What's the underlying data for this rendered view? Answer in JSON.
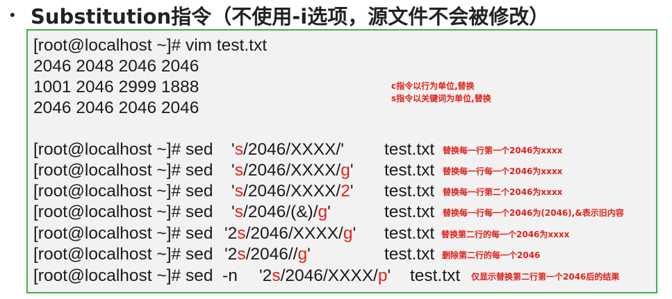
{
  "title": {
    "bullet": "•",
    "text": "Substitution指令（不使用-i选项，源文件不会被修改）"
  },
  "file_content": {
    "command": "[root@localhost ~]# vim test.txt",
    "lines": [
      "2046 2048 2046 2046",
      "1001 2046 2999 1888",
      "2046 2046 2046 2046"
    ]
  },
  "notes": {
    "c_note": "c指令以行为单位,替换",
    "s_note": "s指令以关键词为单位,替换"
  },
  "commands": [
    {
      "prompt": "[root@localhost ~]# sed  ",
      "p1": "'",
      "r1": "s",
      "p2": "/2046/XXXX/'",
      "r2": "",
      "p3": "",
      "file": "test.txt",
      "note": "替换每一行第一个2046为xxxx"
    },
    {
      "prompt": "[root@localhost ~]# sed  ",
      "p1": "'",
      "r1": "s",
      "p2": "/2046/XXXX/",
      "r2": "g",
      "p3": "'",
      "file": "test.txt",
      "note": "替换每一行每一个2046为xxxx"
    },
    {
      "prompt": "[root@localhost ~]# sed  ",
      "p1": "'",
      "r1": "s",
      "p2": "/2046/XXXX/",
      "r2": "2",
      "p3": "'",
      "file": "test.txt",
      "note": "替换每一行第二个2046为xxxx"
    },
    {
      "prompt": "[root@localhost ~]# sed  ",
      "p1": "'",
      "r1": "s",
      "p2": "/2046/(&)/",
      "r2": "g",
      "p3": "'",
      "file": "test.txt",
      "note": "替换每一行每一个2046为(2046),&表示旧内容"
    },
    {
      "prompt": "[root@localhost ~]# sed  ",
      "p1": "'2",
      "r1": "s",
      "p2": "/2046/XXXX/",
      "r2": "g",
      "p3": "'",
      "file": "test.txt",
      "note": "替换第二行的每一个2046为xxxx"
    },
    {
      "prompt": "[root@localhost ~]# sed  ",
      "p1": "'2",
      "r1": "s",
      "p2": "/2046//",
      "r2": "g",
      "p3": "'",
      "file": "test.txt",
      "note": "删除第二行的每一个2046"
    },
    {
      "prompt": "[root@localhost ~]# sed  -n  ",
      "p1": "'2",
      "r1": "s",
      "p2": "/2046/XXXX/",
      "r2": "p",
      "p3": "'",
      "file": "test.txt",
      "note": "仅显示替换第二行第一个2046后的结果"
    }
  ],
  "colors": {
    "accent_red": "#e0201a",
    "border_green": "#3fae48"
  }
}
